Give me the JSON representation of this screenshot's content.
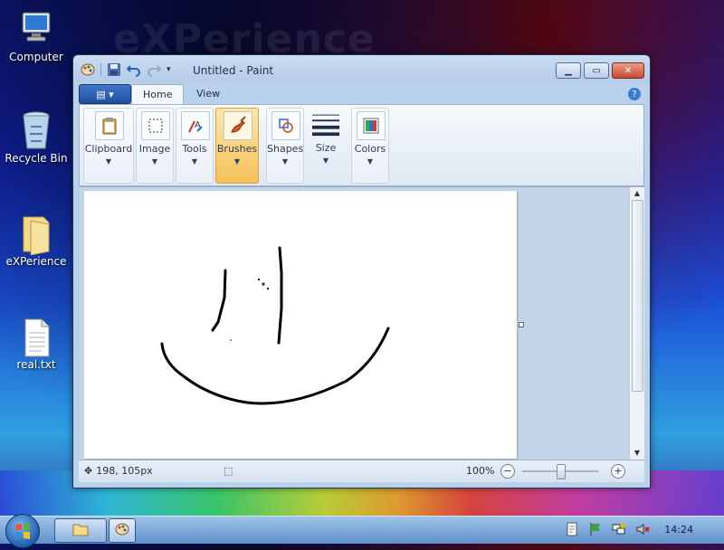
{
  "desktop": {
    "watermark": "eXPerience",
    "icons": [
      {
        "label": "Computer",
        "icon": "computer-icon"
      },
      {
        "label": "Recycle Bin",
        "icon": "recycle-bin-icon"
      },
      {
        "label": "eXPerience",
        "icon": "folder-icon"
      },
      {
        "label": "real.txt",
        "icon": "text-file-icon"
      }
    ]
  },
  "window": {
    "title": "Untitled - Paint",
    "tabs": [
      {
        "label": "Home",
        "active": true
      },
      {
        "label": "View",
        "active": false
      }
    ],
    "ribbon_groups": [
      {
        "label": "Clipboard",
        "icon": "clipboard-icon"
      },
      {
        "label": "Image",
        "icon": "image-select-icon"
      },
      {
        "label": "Tools",
        "icon": "tools-icon"
      },
      {
        "label": "Brushes",
        "icon": "brush-icon",
        "selected": true
      },
      {
        "label": "Shapes",
        "icon": "shapes-icon"
      },
      {
        "label": "Size",
        "icon": "line-size-icon"
      },
      {
        "label": "Colors",
        "icon": "color-palette-icon"
      }
    ],
    "status": {
      "cursor_position": "198, 105px",
      "zoom": "100%"
    },
    "zoom_level": 100
  },
  "taskbar": {
    "clock": "14:24"
  },
  "colors": {
    "accent": "#3f76c9",
    "selected_group": "#f6c15a"
  }
}
